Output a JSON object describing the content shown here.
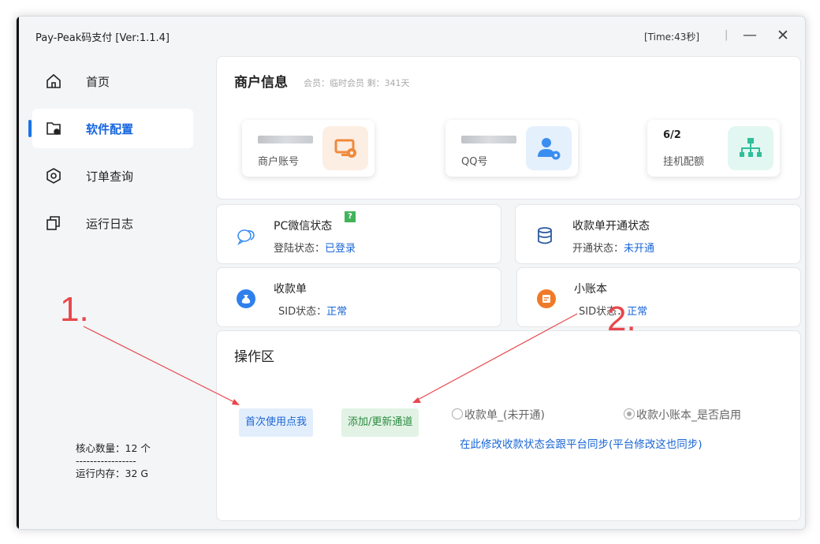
{
  "window": {
    "title": "Pay-Peak码支付  [Ver:1.1.4]",
    "time": "[Time:43秒]",
    "separator": "|",
    "minimize": "—",
    "close": "✕"
  },
  "sidebar": {
    "items": [
      {
        "label": "首页",
        "icon": "home-icon",
        "active": false
      },
      {
        "label": "软件配置",
        "icon": "config-icon",
        "active": true
      },
      {
        "label": "订单查询",
        "icon": "hexagon-settings-icon",
        "active": false
      },
      {
        "label": "运行日志",
        "icon": "copy-icon",
        "active": false
      }
    ],
    "core_count": "核心数量：12 个",
    "divider": "-----------------",
    "memory": "运行内存：32 G"
  },
  "merchant": {
    "title": "商户信息",
    "subtitle": "会员：临时会员 剩：341天",
    "stats": [
      {
        "value": "",
        "label": "商户账号",
        "icon": "screen-gear-icon",
        "color": "#f08a3c"
      },
      {
        "value": "",
        "label": "QQ号",
        "icon": "user-gear-icon",
        "color": "#3b8ef0"
      },
      {
        "value": "6/2",
        "label": "挂机配额",
        "icon": "org-chart-icon",
        "color": "#2fbf9b"
      }
    ]
  },
  "status": {
    "wechat": {
      "title": "PC微信状态",
      "badge": "?",
      "line_label": "登陆状态：",
      "line_value": "已登录"
    },
    "collect_open": {
      "title": "收款单开通状态",
      "line_label": "开通状态：",
      "line_value": "未开通"
    },
    "receipt": {
      "title": "收款单",
      "line_label": "SID状态：",
      "line_value": "正常"
    },
    "ledger": {
      "title": "小账本",
      "line_label": "SID状态：",
      "line_value": "正常"
    }
  },
  "ops": {
    "title": "操作区",
    "btn_first": "首次使用点我",
    "btn_add": "添加/更新通道",
    "radio_receipt": "收款单_(未开通)",
    "radio_ledger": "收款小账本_是否启用",
    "sync_link": "在此修改收款状态会跟平台同步(平台修改这也同步)"
  },
  "annotations": {
    "one": "1.",
    "two": "2.",
    "color": "#e8474c"
  }
}
